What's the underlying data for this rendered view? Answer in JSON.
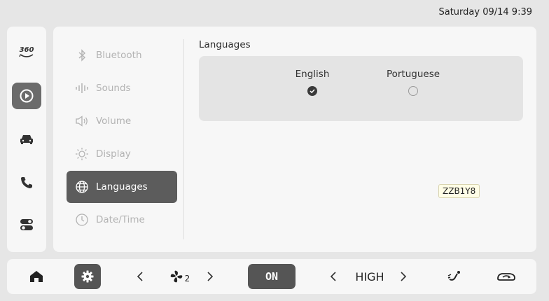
{
  "status": {
    "datetime": "Saturday 09/14 9:39"
  },
  "side_rail": {
    "items": [
      {
        "id": "360",
        "icon": "360-camera-icon",
        "label": "360"
      },
      {
        "id": "media",
        "icon": "play-icon"
      },
      {
        "id": "vehicle",
        "icon": "car-icon"
      },
      {
        "id": "phone",
        "icon": "phone-icon"
      },
      {
        "id": "controls",
        "icon": "toggles-icon"
      }
    ]
  },
  "settings_menu": {
    "items": [
      {
        "label": "Bluetooth",
        "icon": "bluetooth-icon"
      },
      {
        "label": "Sounds",
        "icon": "sound-wave-icon"
      },
      {
        "label": "Volume",
        "icon": "speaker-icon"
      },
      {
        "label": "Display",
        "icon": "brightness-icon"
      },
      {
        "label": "Languages",
        "icon": "globe-icon",
        "active": true
      },
      {
        "label": "Date/Time",
        "icon": "clock-icon"
      }
    ]
  },
  "languages": {
    "title": "Languages",
    "options": [
      {
        "label": "English",
        "selected": true
      },
      {
        "label": "Portuguese",
        "selected": false
      }
    ]
  },
  "tag": {
    "text": "ZZB1Y8"
  },
  "bottom_bar": {
    "home_icon": "home-icon",
    "settings_icon": "gear-icon",
    "fan_level": "2",
    "on_label": "ON",
    "mode_label": "HIGH",
    "airflow_icon": "seat-airflow-icon",
    "recirc_icon": "recirculation-icon"
  },
  "colors": {
    "background": "#e6e6e6",
    "panel": "#f7f7f7",
    "active": "#5c5c5c",
    "card": "#e4e4e4"
  }
}
